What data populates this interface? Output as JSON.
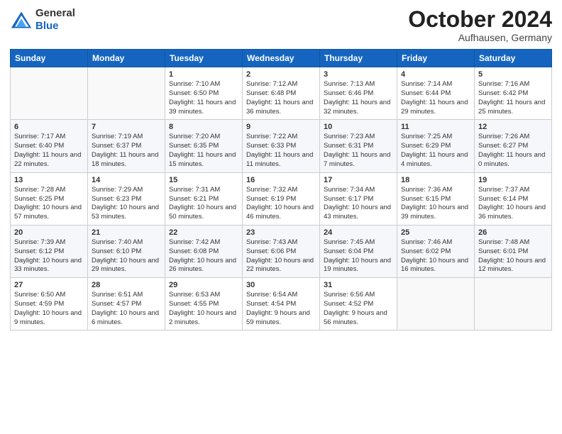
{
  "header": {
    "logo": {
      "general": "General",
      "blue": "Blue"
    },
    "month": "October 2024",
    "location": "Aufhausen, Germany"
  },
  "weekdays": [
    "Sunday",
    "Monday",
    "Tuesday",
    "Wednesday",
    "Thursday",
    "Friday",
    "Saturday"
  ],
  "weeks": [
    [
      {
        "day": "",
        "info": ""
      },
      {
        "day": "",
        "info": ""
      },
      {
        "day": "1",
        "info": "Sunrise: 7:10 AM\nSunset: 6:50 PM\nDaylight: 11 hours and 39 minutes."
      },
      {
        "day": "2",
        "info": "Sunrise: 7:12 AM\nSunset: 6:48 PM\nDaylight: 11 hours and 36 minutes."
      },
      {
        "day": "3",
        "info": "Sunrise: 7:13 AM\nSunset: 6:46 PM\nDaylight: 11 hours and 32 minutes."
      },
      {
        "day": "4",
        "info": "Sunrise: 7:14 AM\nSunset: 6:44 PM\nDaylight: 11 hours and 29 minutes."
      },
      {
        "day": "5",
        "info": "Sunrise: 7:16 AM\nSunset: 6:42 PM\nDaylight: 11 hours and 25 minutes."
      }
    ],
    [
      {
        "day": "6",
        "info": "Sunrise: 7:17 AM\nSunset: 6:40 PM\nDaylight: 11 hours and 22 minutes."
      },
      {
        "day": "7",
        "info": "Sunrise: 7:19 AM\nSunset: 6:37 PM\nDaylight: 11 hours and 18 minutes."
      },
      {
        "day": "8",
        "info": "Sunrise: 7:20 AM\nSunset: 6:35 PM\nDaylight: 11 hours and 15 minutes."
      },
      {
        "day": "9",
        "info": "Sunrise: 7:22 AM\nSunset: 6:33 PM\nDaylight: 11 hours and 11 minutes."
      },
      {
        "day": "10",
        "info": "Sunrise: 7:23 AM\nSunset: 6:31 PM\nDaylight: 11 hours and 7 minutes."
      },
      {
        "day": "11",
        "info": "Sunrise: 7:25 AM\nSunset: 6:29 PM\nDaylight: 11 hours and 4 minutes."
      },
      {
        "day": "12",
        "info": "Sunrise: 7:26 AM\nSunset: 6:27 PM\nDaylight: 11 hours and 0 minutes."
      }
    ],
    [
      {
        "day": "13",
        "info": "Sunrise: 7:28 AM\nSunset: 6:25 PM\nDaylight: 10 hours and 57 minutes."
      },
      {
        "day": "14",
        "info": "Sunrise: 7:29 AM\nSunset: 6:23 PM\nDaylight: 10 hours and 53 minutes."
      },
      {
        "day": "15",
        "info": "Sunrise: 7:31 AM\nSunset: 6:21 PM\nDaylight: 10 hours and 50 minutes."
      },
      {
        "day": "16",
        "info": "Sunrise: 7:32 AM\nSunset: 6:19 PM\nDaylight: 10 hours and 46 minutes."
      },
      {
        "day": "17",
        "info": "Sunrise: 7:34 AM\nSunset: 6:17 PM\nDaylight: 10 hours and 43 minutes."
      },
      {
        "day": "18",
        "info": "Sunrise: 7:36 AM\nSunset: 6:15 PM\nDaylight: 10 hours and 39 minutes."
      },
      {
        "day": "19",
        "info": "Sunrise: 7:37 AM\nSunset: 6:14 PM\nDaylight: 10 hours and 36 minutes."
      }
    ],
    [
      {
        "day": "20",
        "info": "Sunrise: 7:39 AM\nSunset: 6:12 PM\nDaylight: 10 hours and 33 minutes."
      },
      {
        "day": "21",
        "info": "Sunrise: 7:40 AM\nSunset: 6:10 PM\nDaylight: 10 hours and 29 minutes."
      },
      {
        "day": "22",
        "info": "Sunrise: 7:42 AM\nSunset: 6:08 PM\nDaylight: 10 hours and 26 minutes."
      },
      {
        "day": "23",
        "info": "Sunrise: 7:43 AM\nSunset: 6:06 PM\nDaylight: 10 hours and 22 minutes."
      },
      {
        "day": "24",
        "info": "Sunrise: 7:45 AM\nSunset: 6:04 PM\nDaylight: 10 hours and 19 minutes."
      },
      {
        "day": "25",
        "info": "Sunrise: 7:46 AM\nSunset: 6:02 PM\nDaylight: 10 hours and 16 minutes."
      },
      {
        "day": "26",
        "info": "Sunrise: 7:48 AM\nSunset: 6:01 PM\nDaylight: 10 hours and 12 minutes."
      }
    ],
    [
      {
        "day": "27",
        "info": "Sunrise: 6:50 AM\nSunset: 4:59 PM\nDaylight: 10 hours and 9 minutes."
      },
      {
        "day": "28",
        "info": "Sunrise: 6:51 AM\nSunset: 4:57 PM\nDaylight: 10 hours and 6 minutes."
      },
      {
        "day": "29",
        "info": "Sunrise: 6:53 AM\nSunset: 4:55 PM\nDaylight: 10 hours and 2 minutes."
      },
      {
        "day": "30",
        "info": "Sunrise: 6:54 AM\nSunset: 4:54 PM\nDaylight: 9 hours and 59 minutes."
      },
      {
        "day": "31",
        "info": "Sunrise: 6:56 AM\nSunset: 4:52 PM\nDaylight: 9 hours and 56 minutes."
      },
      {
        "day": "",
        "info": ""
      },
      {
        "day": "",
        "info": ""
      }
    ]
  ]
}
